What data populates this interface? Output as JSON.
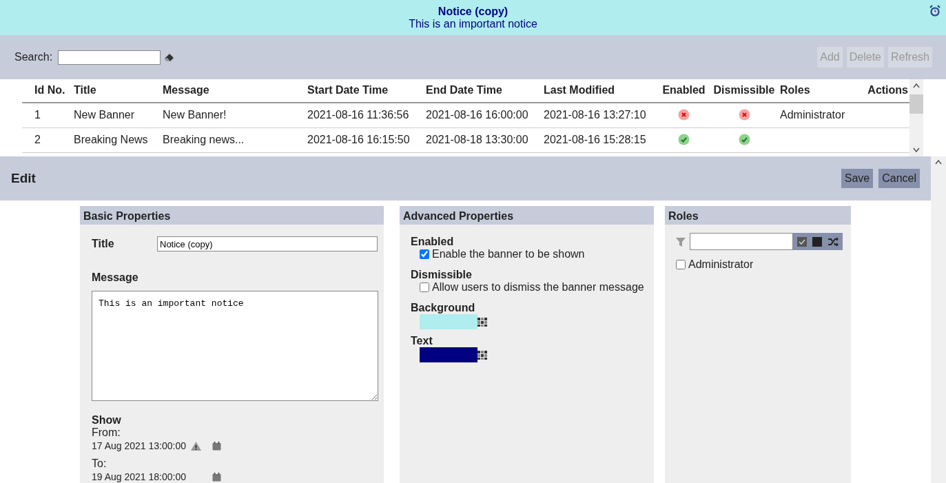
{
  "banner": {
    "title": "Notice (copy)",
    "message": "This is an important notice"
  },
  "toolbar": {
    "search_label": "Search:",
    "buttons": [
      {
        "label": "Add",
        "disabled": true
      },
      {
        "label": "Delete",
        "disabled": true
      },
      {
        "label": "Refresh",
        "disabled": true
      }
    ]
  },
  "table": {
    "columns": [
      "Id No.",
      "Title",
      "Message",
      "Start Date Time",
      "End Date Time",
      "Last Modified",
      "Enabled",
      "Dismissible",
      "Roles",
      "Actions"
    ],
    "rows": [
      {
        "cells": [
          "1",
          "New Banner",
          "New Banner!",
          "2021-08-16 11:36:56",
          "2021-08-16 16:00:00",
          "2021-08-16 13:27:10"
        ],
        "enabled": false,
        "dismissible": false,
        "roles": "Administrator"
      },
      {
        "cells": [
          "2",
          "Breaking News",
          "Breaking news...",
          "2021-08-16 16:15:50",
          "2021-08-18 13:30:00",
          "2021-08-16 15:28:15"
        ],
        "enabled": true,
        "dismissible": true
      }
    ]
  },
  "edit": {
    "title": "Edit",
    "buttons": [
      "Save",
      "Cancel"
    ]
  },
  "basic": {
    "heading": "Basic Properties",
    "title_label": "Title",
    "title_value": "Notice (copy)",
    "message_label": "Message",
    "message_value": "This is an important notice",
    "show_label": "Show",
    "from_label": "From:",
    "from_value": "17 Aug 2021 13:00:00",
    "from_warning": true,
    "to_label": "To:",
    "to_value": "19 Aug 2021 18:00:00"
  },
  "advanced": {
    "heading": "Advanced Properties",
    "options": [
      {
        "label": "Enabled",
        "text": "Enable the banner to be shown",
        "checked": true
      },
      {
        "label": "Dismissible",
        "text": "Allow users to dismiss the banner message",
        "checked": false
      }
    ],
    "colors": [
      {
        "label": "Background",
        "color": "#afedee"
      },
      {
        "label": "Text",
        "color": "#000080"
      }
    ]
  },
  "roles": {
    "heading": "Roles",
    "items": [
      {
        "label": "Administrator",
        "checked": false
      }
    ]
  }
}
